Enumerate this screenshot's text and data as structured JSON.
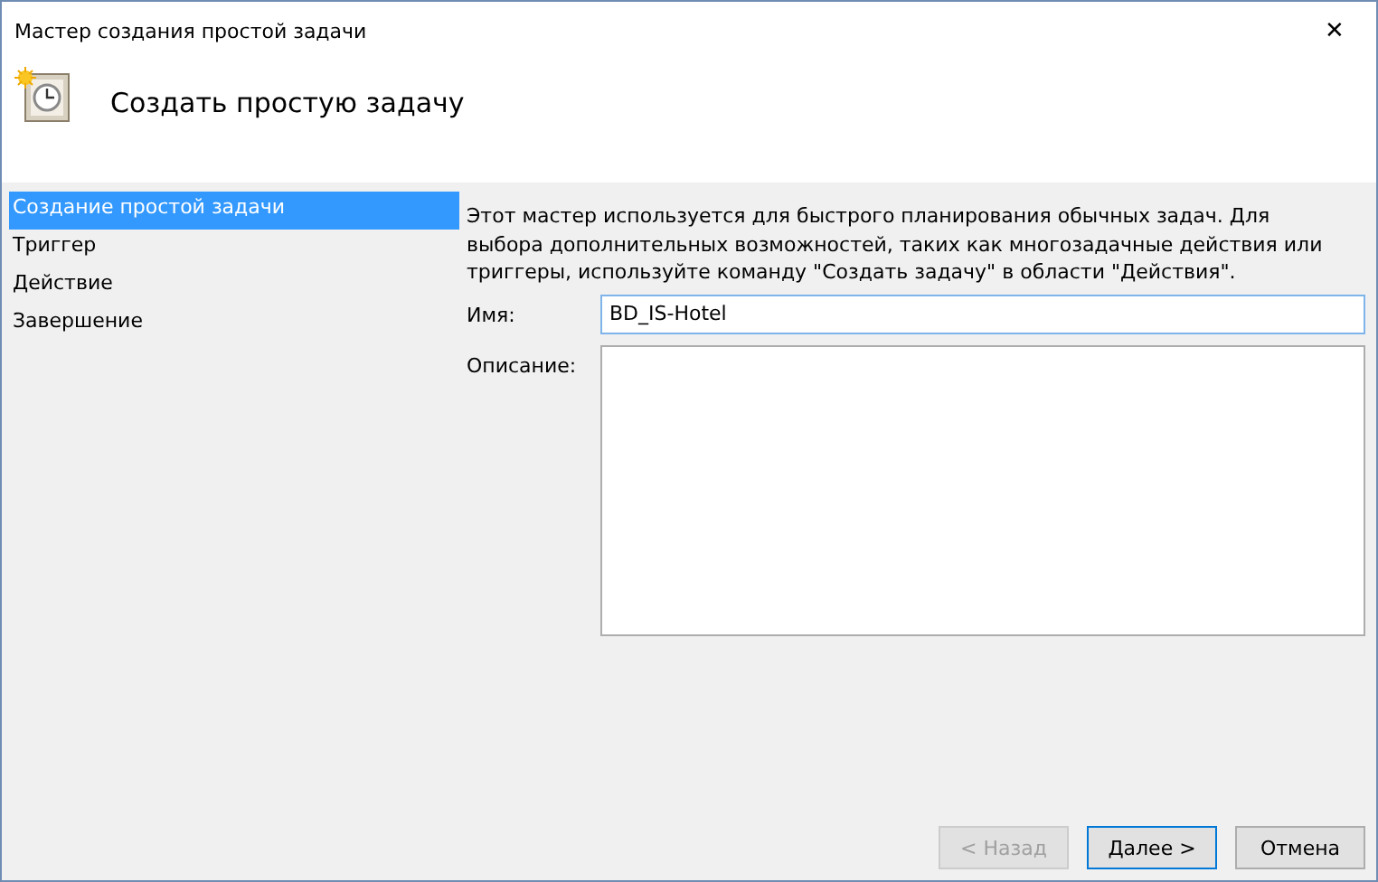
{
  "window": {
    "title": "Мастер создания простой задачи",
    "close": "✕"
  },
  "header": {
    "title": "Создать простую задачу"
  },
  "steps": [
    {
      "label": "Создание простой задачи",
      "selected": true
    },
    {
      "label": "Триггер",
      "selected": false
    },
    {
      "label": "Действие",
      "selected": false
    },
    {
      "label": "Завершение",
      "selected": false
    }
  ],
  "intro": "Этот мастер используется для быстрого планирования обычных задач.  Для выбора дополнительных возможностей, таких как многозадачные действия или триггеры, используйте команду \"Создать задачу\" в области \"Действия\".",
  "name_field": {
    "label": "Имя:",
    "value": "BD_IS-Hotel"
  },
  "description_field": {
    "label": "Описание:"
  },
  "buttons": [
    {
      "label": "< Назад",
      "disabled": true,
      "default": false
    },
    {
      "label": "Далее >",
      "disabled": false,
      "default": true
    },
    {
      "label": "Отмена",
      "disabled": false,
      "default": false
    }
  ]
}
